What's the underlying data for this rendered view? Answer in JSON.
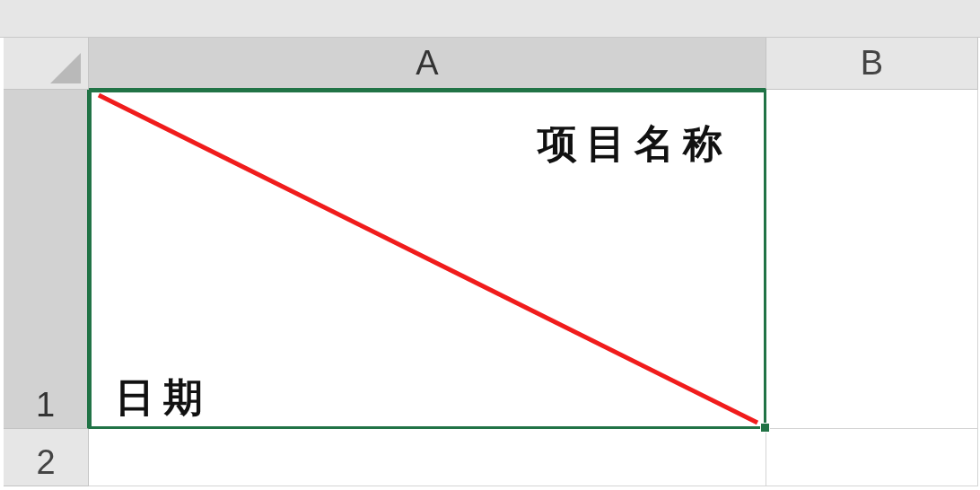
{
  "columns": [
    {
      "label": "A",
      "selected": true
    },
    {
      "label": "B",
      "selected": false
    }
  ],
  "rows": [
    {
      "label": "1",
      "selected": true
    },
    {
      "label": "2",
      "selected": false
    }
  ],
  "active_cell": {
    "top_right_text": "项目名称",
    "bottom_left_text": "日期",
    "diagonal_border": true
  }
}
